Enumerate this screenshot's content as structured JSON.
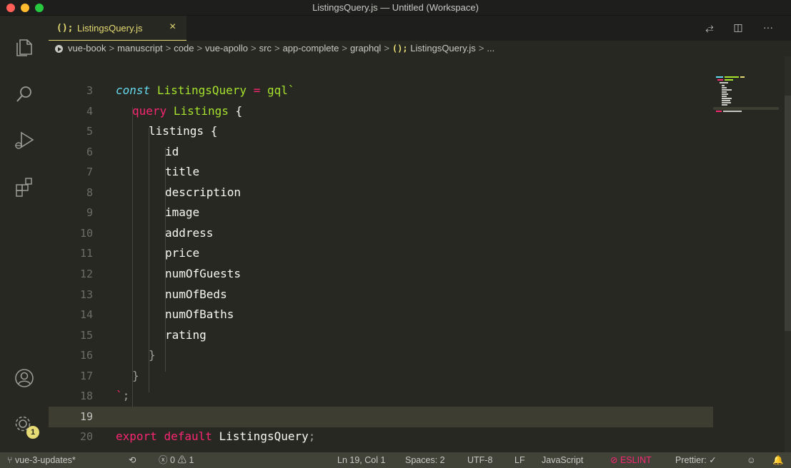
{
  "window": {
    "title": "ListingsQuery.js — Untitled (Workspace)"
  },
  "tab": {
    "icon": "(); ",
    "label": "ListingsQuery.js",
    "close": "×"
  },
  "tab_actions": {
    "compare": "⥄",
    "split": "◫",
    "more": "···"
  },
  "breadcrumb": {
    "items": [
      "vue-book",
      "manuscript",
      "code",
      "vue-apollo",
      "src",
      "app-complete",
      "graphql"
    ],
    "file_icon": "();",
    "file": "ListingsQuery.js",
    "trailing": "...",
    "separator": ">"
  },
  "editor": {
    "line_numbers": [
      "3",
      "4",
      "5",
      "6",
      "7",
      "8",
      "9",
      "10",
      "11",
      "12",
      "13",
      "14",
      "15",
      "16",
      "17",
      "18",
      "19",
      "20"
    ],
    "current_line": "19",
    "line_3": {
      "kw": "const",
      "name": "ListingsQuery",
      "eq": "=",
      "tag": "gql`"
    },
    "line_4": {
      "kw": "query",
      "name": "Listings",
      "brace": "{"
    },
    "line_5": {
      "name": "listings",
      "brace": "{"
    },
    "fields": [
      "id",
      "title",
      "description",
      "image",
      "address",
      "price",
      "numOfGuests",
      "numOfBeds",
      "numOfBaths",
      "rating"
    ],
    "line_16": "}",
    "line_17": "}",
    "line_18": {
      "tick": "`",
      "semi": ";"
    },
    "line_20": {
      "kw1": "export",
      "kw2": "default",
      "name": "ListingsQuery",
      "semi": ";"
    }
  },
  "activity_badge": "1",
  "statusbar": {
    "branch": "vue-3-updates*",
    "sync": "⟲",
    "errors": "0",
    "warnings": "1",
    "position": "Ln 19, Col 1",
    "spaces": "Spaces: 2",
    "encoding": "UTF-8",
    "eol": "LF",
    "language": "JavaScript",
    "eslint": "ESLINT",
    "prettier": "Prettier: ✓"
  },
  "colors": {
    "background": "#272822",
    "accent": "#e6db74",
    "keyword": "#f92672",
    "storage": "#66d9ef",
    "function": "#a6e22e",
    "statusbar": "#414339"
  }
}
